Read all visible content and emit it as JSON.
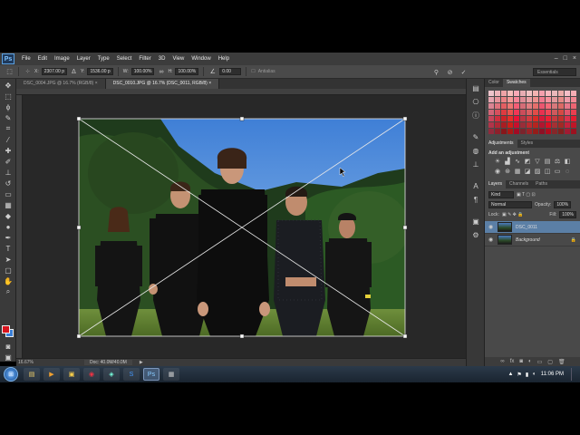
{
  "app": {
    "logo": "Ps"
  },
  "menu": [
    "File",
    "Edit",
    "Image",
    "Layer",
    "Type",
    "Select",
    "Filter",
    "3D",
    "View",
    "Window",
    "Help"
  ],
  "window_controls": [
    "–",
    "□",
    "×"
  ],
  "options_bar": {
    "x_label": "X:",
    "x_value": "2307.00 p",
    "y_label": "Y:",
    "y_value": "1536.00 p",
    "w_label": "W:",
    "w_value": "100.00%",
    "h_label": "H:",
    "h_value": "100.00%",
    "angle_value": "0.00",
    "antialias_label": "Antialias",
    "workspace": "Essentials"
  },
  "doc_tabs": [
    {
      "label": "DSC_0004.JPG @ 16.7% (RGB/8) ×",
      "active": false
    },
    {
      "label": "DSC_0010.JPG @ 16.7% (DSC_0011, RGB/8) ×",
      "active": true
    }
  ],
  "status": {
    "zoom": "16.67%",
    "doc": "Doc: 40.0M/40.0M"
  },
  "panels": {
    "top_tabs": [
      "Color",
      "Swatches"
    ],
    "adj_tabs": [
      "Adjustments",
      "Styles"
    ],
    "adj_title": "Add an adjustment",
    "layer_tabs": [
      "Layers",
      "Channels",
      "Paths"
    ],
    "kind_label": "Kind",
    "blend_mode": "Normal",
    "opacity_label": "Opacity:",
    "opacity_value": "100%",
    "lock_label": "Lock:",
    "fill_label": "Fill:",
    "fill_value": "100%",
    "layers": [
      {
        "name": "DSC_0011",
        "active": true
      },
      {
        "name": "Background",
        "active": false
      }
    ]
  },
  "taskbar": {
    "clock": "11:06 PM"
  }
}
